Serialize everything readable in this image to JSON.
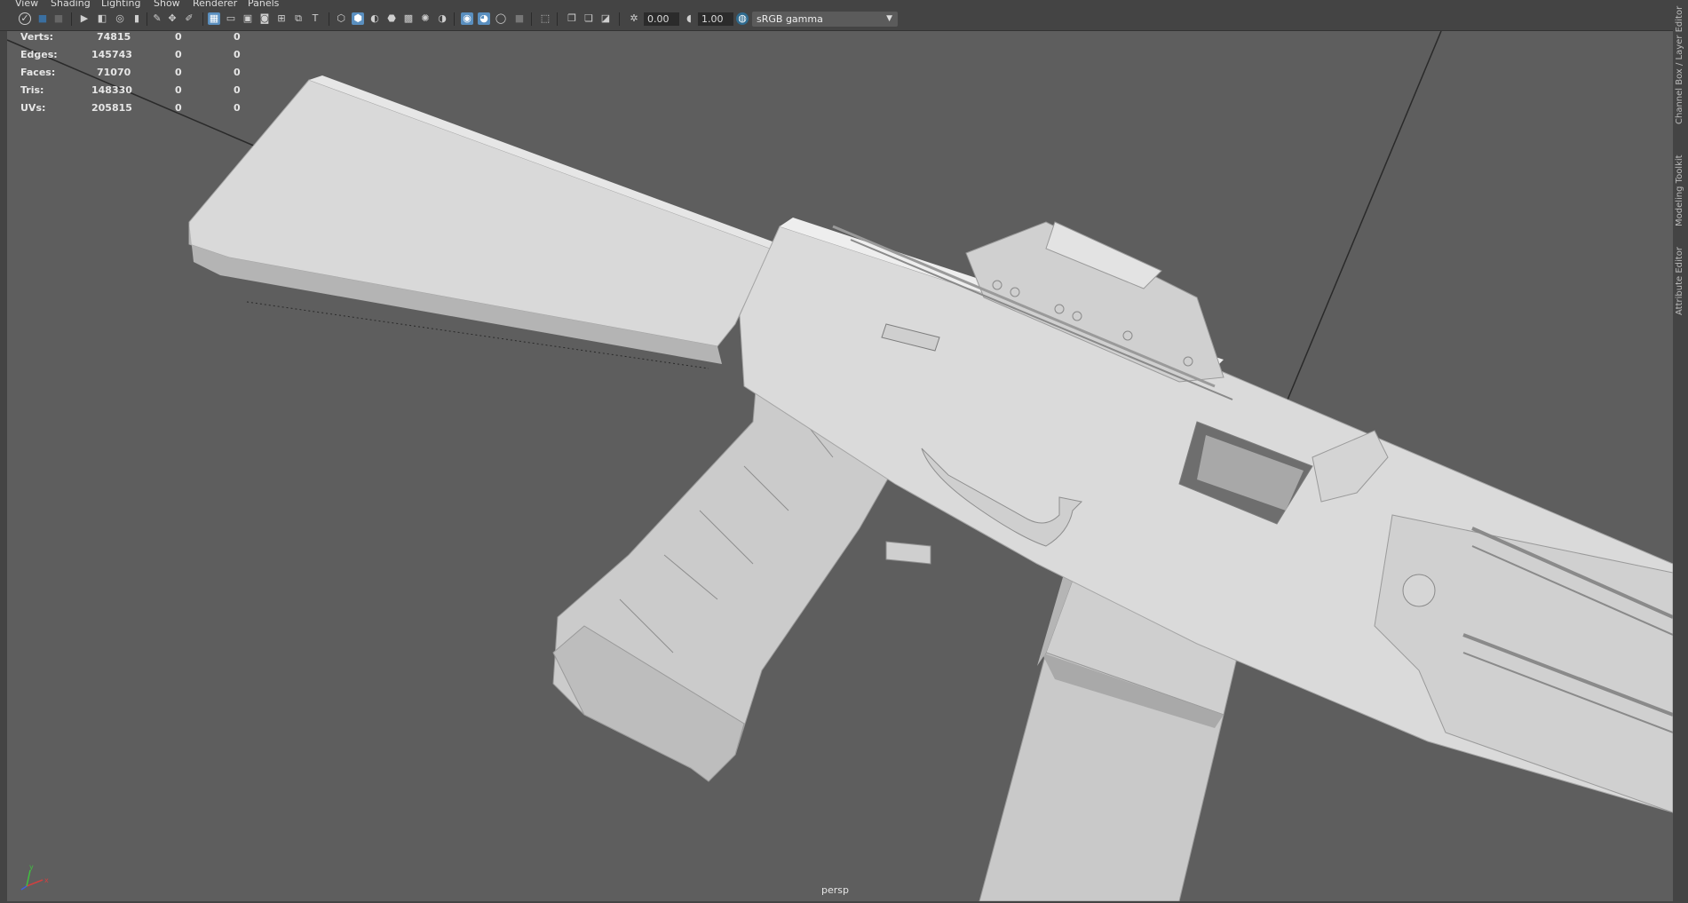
{
  "menu": [
    "View",
    "Shading",
    "Lighting",
    "Show",
    "Renderer",
    "Panels"
  ],
  "toolbar": {
    "exposure_value": "0.00",
    "gamma_value": "1.00",
    "color_space": "sRGB gamma"
  },
  "hud": {
    "rows": [
      {
        "label": "Verts:",
        "v1": "74815",
        "v2": "0",
        "v3": "0"
      },
      {
        "label": "Edges:",
        "v1": "145743",
        "v2": "0",
        "v3": "0"
      },
      {
        "label": "Faces:",
        "v1": "71070",
        "v2": "0",
        "v3": "0"
      },
      {
        "label": "Tris:",
        "v1": "148330",
        "v2": "0",
        "v3": "0"
      },
      {
        "label": "UVs:",
        "v1": "205815",
        "v2": "0",
        "v3": "0"
      }
    ]
  },
  "camera_label": "persp",
  "dock_tabs": [
    "Channel Box / Layer Editor",
    "Modeling Toolkit",
    "Attribute Editor"
  ],
  "axis_labels": {
    "x": "x",
    "y": "y",
    "z": "z"
  },
  "colors": {
    "viewport_bg": "#5e5e5e",
    "ui_bg": "#444444",
    "accent": "#5a8fbf",
    "model": "#d4d4d4"
  }
}
